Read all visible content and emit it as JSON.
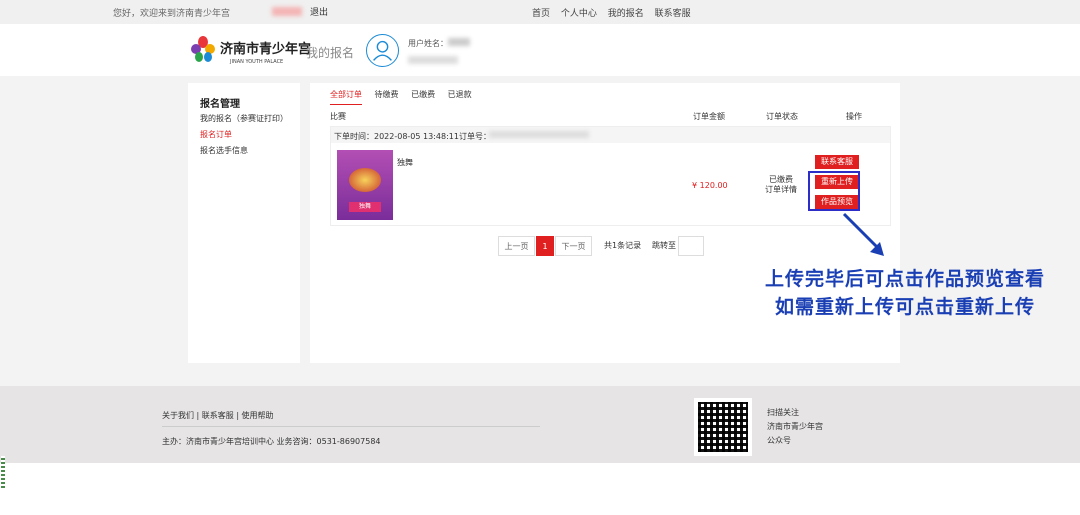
{
  "topbar": {
    "welcome": "您好，欢迎来到济南青少年宫",
    "logout": "退出",
    "nav": [
      "首页",
      "个人中心",
      "我的报名",
      "联系客服"
    ]
  },
  "header": {
    "logo_name": "济南市青少年宫",
    "logo_en": "JINAN YOUTH PALACE",
    "page_label": "我的报名",
    "username_label": "用户姓名："
  },
  "sidebar": {
    "title": "报名管理",
    "items": [
      {
        "label": "我的报名（参赛证打印）",
        "active": false
      },
      {
        "label": "报名订单",
        "active": true
      },
      {
        "label": "报名选手信息",
        "active": false
      }
    ]
  },
  "tabs": [
    "全部订单",
    "待缴费",
    "已缴费",
    "已退款"
  ],
  "table": {
    "columns": [
      "比赛",
      "订单金额",
      "订单状态",
      "操作"
    ]
  },
  "order": {
    "time_label": "下单时间：2022-08-05 13:48:11",
    "no_label": "订单号：",
    "poster_label": "独舞",
    "product": "独舞",
    "price": "¥ 120.00",
    "status": "已缴费",
    "detail_link": "订单详情",
    "buttons": [
      "联系客服",
      "重新上传",
      "作品预览"
    ]
  },
  "pager": {
    "prev": "上一页",
    "current": "1",
    "next": "下一页",
    "total": "共1条记录",
    "jump": "跳转至"
  },
  "annotation": {
    "line1": "上传完毕后可点击作品预览查看",
    "line2": "如需重新上传可点击重新上传",
    "color": "#1a3fb4"
  },
  "footer": {
    "links": "关于我们 | 联系客服 | 使用帮助",
    "info": "主办：济南市青少年宫培训中心 业务咨询：0531-86907584",
    "scan_lines": [
      "扫描关注",
      "济南市青少年宫",
      "公众号"
    ]
  },
  "colors": {
    "accent": "#e02020",
    "avatar": "#1c8bd6"
  }
}
